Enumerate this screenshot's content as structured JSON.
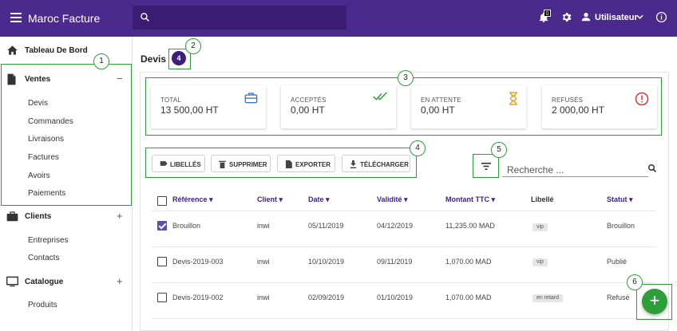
{
  "app": {
    "title": "Maroc Facture"
  },
  "header": {
    "search_placeholder": "",
    "notification_count": "0",
    "username": "Utilisateur"
  },
  "sidebar": {
    "dashboard": "Tableau De Bord",
    "sections": [
      {
        "label": "Ventes",
        "toggle": "−",
        "items": [
          "Devis",
          "Commandes",
          "Livraisons",
          "Factures",
          "Avoirs",
          "Paiements"
        ]
      },
      {
        "label": "Clients",
        "toggle": "+",
        "items": [
          "Entreprises",
          "Contacts"
        ]
      },
      {
        "label": "Catalogue",
        "toggle": "+",
        "items": [
          "Produits"
        ]
      }
    ]
  },
  "main": {
    "page_title": "Devis",
    "count": "4",
    "cards": [
      {
        "label": "TOTAL",
        "value": "13 500,00 HT",
        "icon": "briefcase-icon",
        "color": "#3a78c9"
      },
      {
        "label": "ACCEPTÉS",
        "value": "0,00 HT",
        "icon": "double-check-icon",
        "color": "#2e9e3a"
      },
      {
        "label": "EN ATTENTE",
        "value": "0,00 HT",
        "icon": "hourglass-icon",
        "color": "#e0a020"
      },
      {
        "label": "REFUSÉS",
        "value": "2 000,00 HT",
        "icon": "alert-circle-icon",
        "color": "#d83a3a"
      }
    ],
    "actions": {
      "labels": "LIBELLÉS",
      "delete": "SUPPRIMER",
      "export": "EXPORTER",
      "download": "TÉLÉCHARGER"
    },
    "search_placeholder": "Recherche ...",
    "table": {
      "headers": {
        "reference": "Référence ▾",
        "client": "Client ▾",
        "date": "Date ▾",
        "validity": "Validité ▾",
        "amount": "Montant TTC ▾",
        "label": "Libellé",
        "status": "Statut ▾"
      },
      "rows": [
        {
          "checked": true,
          "reference": "Brouillon",
          "client": "inwi",
          "date": "05/11/2019",
          "validity": "04/12/2019",
          "amount": "11,235.00 MAD",
          "tag": "vip",
          "status": "Brouillon"
        },
        {
          "checked": false,
          "reference": "Devis-2019-003",
          "client": "inwi",
          "date": "10/10/2019",
          "validity": "09/11/2019",
          "amount": "1,070.00 MAD",
          "tag": "vip",
          "status": "Publié"
        },
        {
          "checked": false,
          "reference": "Devis-2019-002",
          "client": "inwi",
          "date": "02/09/2019",
          "validity": "01/10/2019",
          "amount": "1,070.00 MAD",
          "tag": "en retard",
          "status": "Refusé"
        }
      ]
    },
    "fab_label": "+"
  },
  "annotations": [
    "1",
    "2",
    "3",
    "4",
    "5",
    "6"
  ],
  "colors": {
    "appbar": "#4a2a8c",
    "accent": "#3b1f7a",
    "annotation": "#2e9e3a"
  }
}
